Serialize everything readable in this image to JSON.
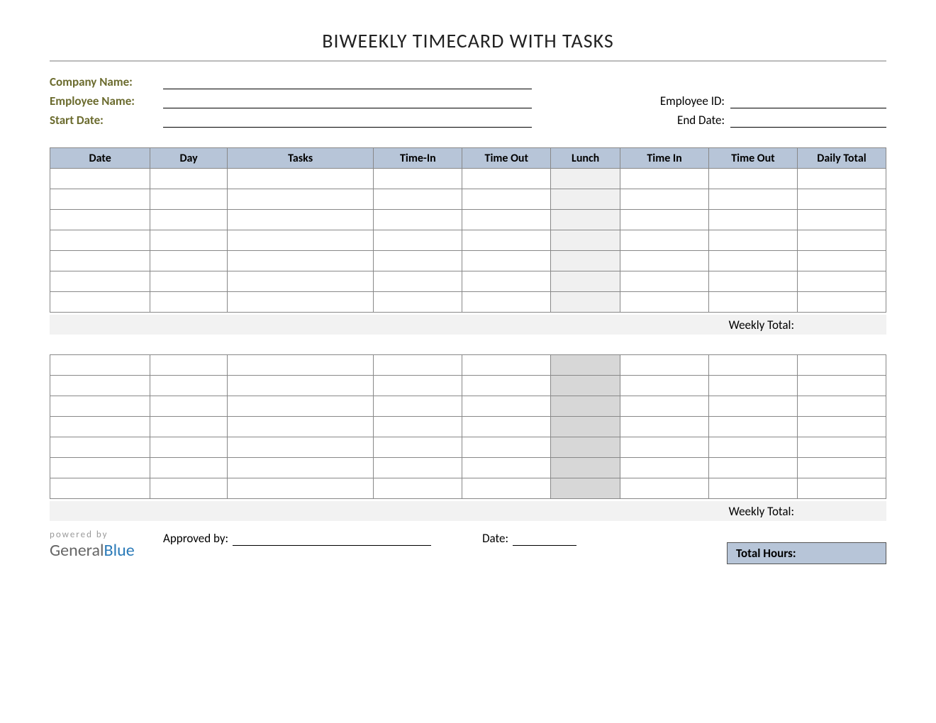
{
  "title": "BIWEEKLY TIMECARD WITH TASKS",
  "labels": {
    "company": "Company Name:",
    "employee": "Employee Name:",
    "start": "Start Date:",
    "empid": "Employee ID:",
    "end": "End Date:",
    "approved": "Approved by:",
    "date_lbl": "Date:",
    "weekly_total": "Weekly Total:",
    "total_hours": "Total Hours:",
    "powered": "powered by",
    "gb_general": "General",
    "gb_blue": "Blue"
  },
  "columns": [
    "Date",
    "Day",
    "Tasks",
    "Time-In",
    "Time Out",
    "Lunch",
    "Time In",
    "Time Out",
    "Daily Total"
  ],
  "week1_rows": 7,
  "week2_rows": 7
}
